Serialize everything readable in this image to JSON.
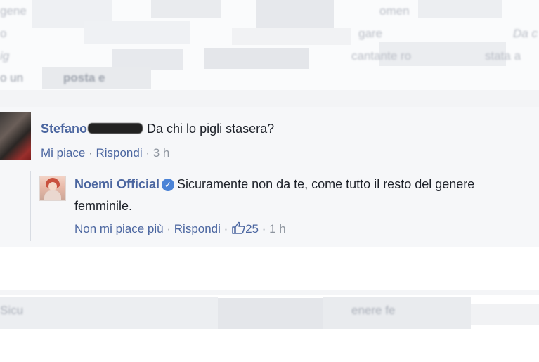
{
  "background_fragments": {
    "line1": "gene",
    "line1b": "omen",
    "line2": "o",
    "line2b": "gare",
    "line2c": "Da c",
    "line3": "ig",
    "line3b": "cantante ro",
    "line3c": "stata a",
    "line4": "o un",
    "line4b": "posta e",
    "bottom1": "Sicu",
    "bottom2": "enere fe"
  },
  "comment": {
    "author_first": "Stefano",
    "text": "Da chi lo pigli stasera?",
    "like_label": "Mi piace",
    "separator": "·",
    "reply_label": "Rispondi",
    "time": "3 h"
  },
  "reply": {
    "author": "Noemi Official",
    "verified_icon": "✓",
    "text_line1": "Sicuramente non da te, come tutto il resto del genere",
    "text_line2": "femminile.",
    "unlike_label": "Non mi piace più",
    "separator": "·",
    "reply_label": "Rispondi",
    "like_count": "25",
    "time": "1 h"
  },
  "colors": {
    "link_blue": "#4b66a0",
    "meta_gray": "#8d949e",
    "verified_blue": "#4b83d6"
  }
}
